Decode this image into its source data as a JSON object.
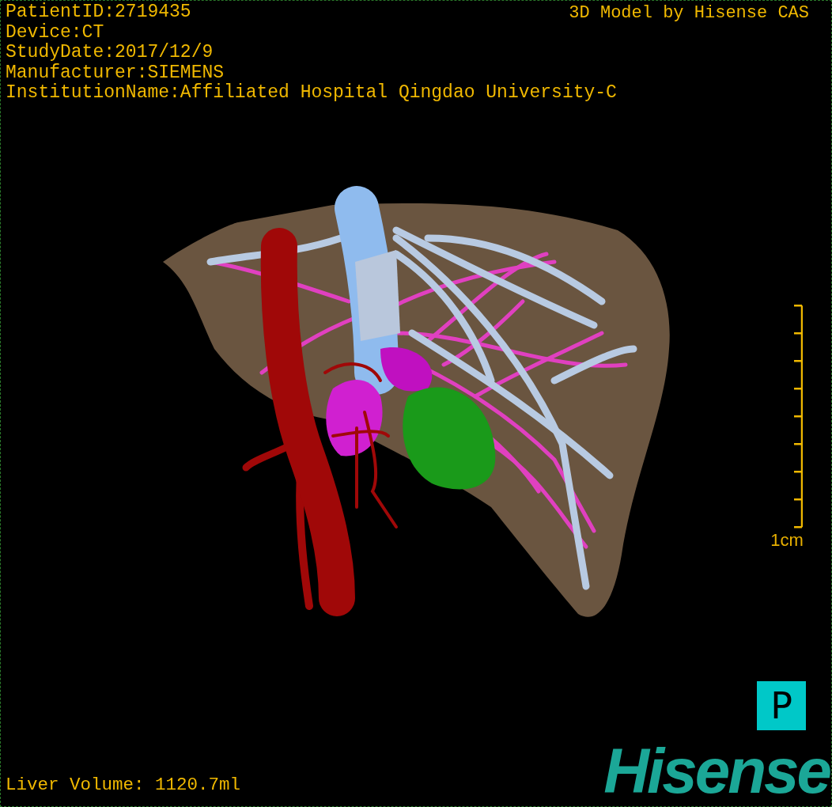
{
  "viewer": {
    "info_lines": [
      "PatientID:2719435",
      "Device:CT",
      "StudyDate:2017/12/9",
      "Manufacturer:SIEMENS",
      "InstitutionName:Affiliated Hospital Qingdao University-C"
    ],
    "credit": "3D Model by Hisense CAS",
    "scale_bar": {
      "label": "1cm"
    },
    "orientation_marker": "P",
    "volume": "Liver Volume: 1120.7ml",
    "logo": "Hisense"
  }
}
